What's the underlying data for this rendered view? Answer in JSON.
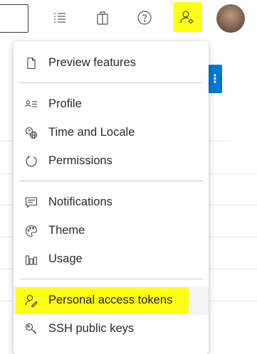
{
  "top_bar": {
    "icons": [
      "task-list-icon",
      "shopping-bag-icon",
      "help-icon",
      "user-settings-icon"
    ]
  },
  "user_menu": {
    "sections": [
      [
        {
          "label": "Preview features",
          "icon": "document-icon"
        }
      ],
      [
        {
          "label": "Profile",
          "icon": "profile-card-icon"
        },
        {
          "label": "Time and Locale",
          "icon": "clock-globe-icon"
        },
        {
          "label": "Permissions",
          "icon": "permissions-icon"
        }
      ],
      [
        {
          "label": "Notifications",
          "icon": "notifications-icon"
        },
        {
          "label": "Theme",
          "icon": "palette-icon"
        },
        {
          "label": "Usage",
          "icon": "usage-chart-icon"
        }
      ],
      [
        {
          "label": "Personal access tokens",
          "icon": "access-token-icon",
          "highlighted": true
        },
        {
          "label": "SSH public keys",
          "icon": "key-icon"
        }
      ]
    ]
  },
  "colors": {
    "highlight": "#ffff14",
    "accent_blue": "#0078d4",
    "text": "#2b2b2b"
  }
}
